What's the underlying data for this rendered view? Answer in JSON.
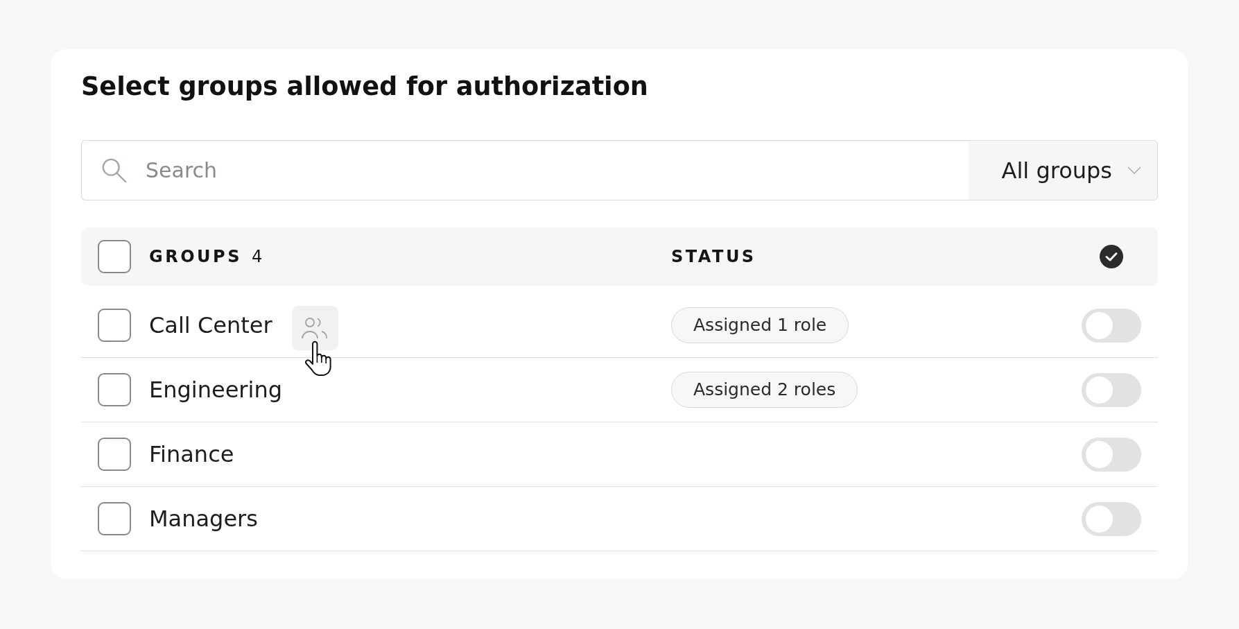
{
  "title": "Select groups allowed for authorization",
  "search": {
    "placeholder": "Search"
  },
  "filter": {
    "value": "All groups"
  },
  "table": {
    "header": {
      "checked": false,
      "columns": [
        {
          "label": "GROUPS",
          "count": "4"
        },
        {
          "label": "STATUS"
        }
      ]
    },
    "rows": [
      {
        "name": "Call Center",
        "checked": false,
        "hovered": true,
        "status": "Assigned 1 role",
        "on": false
      },
      {
        "name": "Engineering",
        "checked": false,
        "hovered": false,
        "status": "Assigned 2 roles",
        "on": false
      },
      {
        "name": "Finance",
        "checked": false,
        "hovered": false,
        "on": false
      },
      {
        "name": "Managers",
        "checked": false,
        "hovered": false,
        "on": false
      }
    ]
  }
}
